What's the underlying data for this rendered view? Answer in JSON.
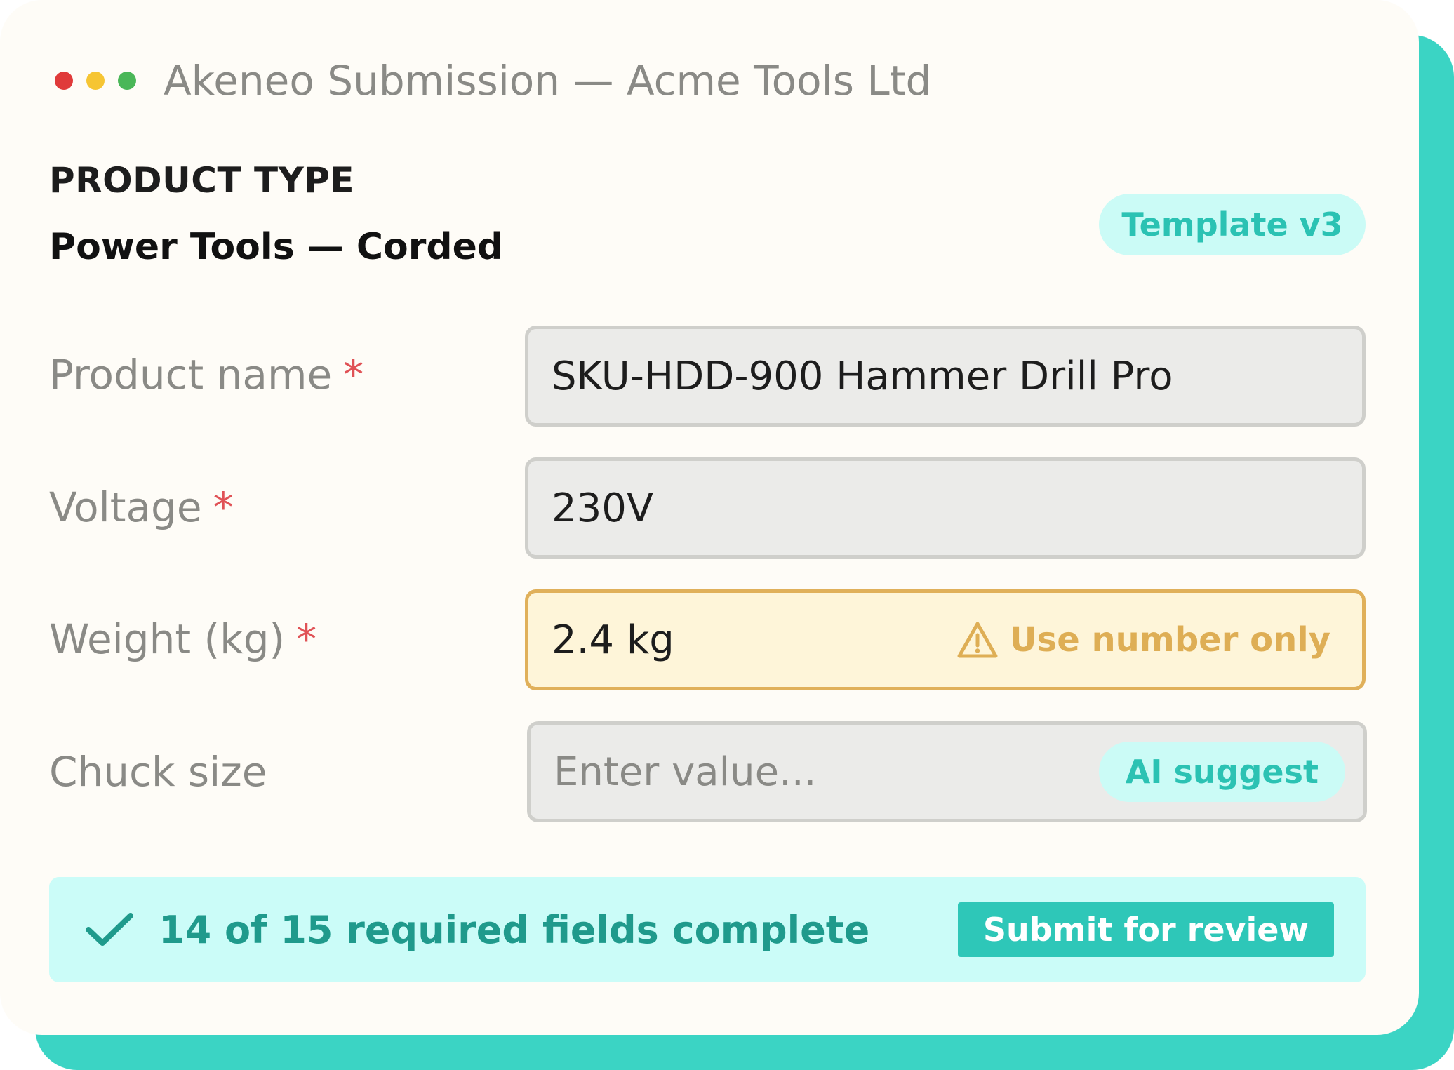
{
  "window": {
    "title": "Akeneo Submission — Acme Tools Ltd"
  },
  "product": {
    "section_label": "PRODUCT TYPE",
    "type": "Power Tools — Corded",
    "template_badge": "Template v3"
  },
  "fields": [
    {
      "label": "Product name",
      "required": "*",
      "value": "SKU-HDD-900 Hammer Drill Pro"
    },
    {
      "label": "Voltage",
      "required": "*",
      "value": "230V"
    },
    {
      "label": "Weight (kg)",
      "required": "*",
      "value": "2.4 kg",
      "warning": "Use number only"
    },
    {
      "label": "Chuck size",
      "placeholder": "Enter value...",
      "ai_button": "AI suggest"
    }
  ],
  "status": {
    "text": "14 of 15 required fields complete",
    "submit_label": "Submit for review"
  },
  "colors": {
    "accent": "#2ec7b8",
    "warning": "#deae55",
    "required": "#e05256"
  }
}
